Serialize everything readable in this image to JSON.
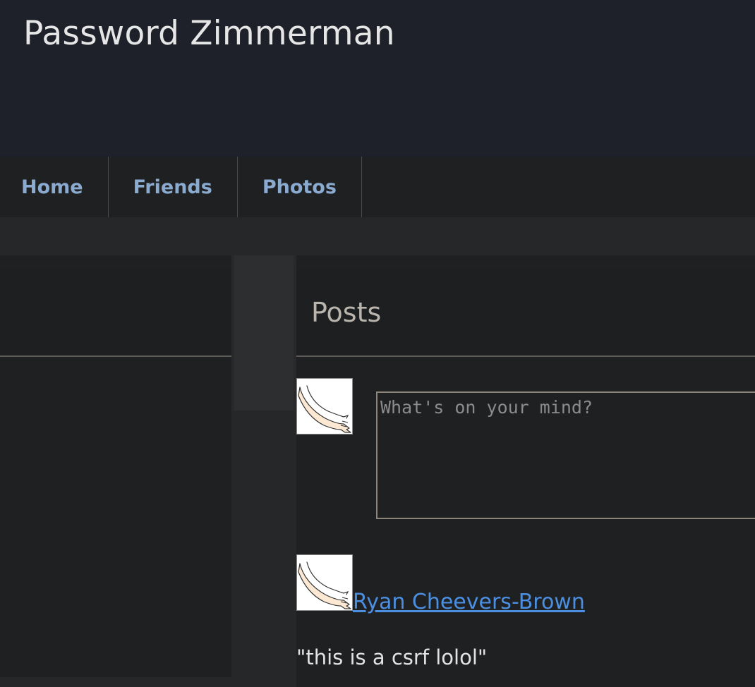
{
  "header": {
    "title": "Password Zimmerman"
  },
  "nav": {
    "items": [
      {
        "label": "Home"
      },
      {
        "label": "Friends"
      },
      {
        "label": "Photos"
      }
    ]
  },
  "posts": {
    "title": "Posts",
    "compose_placeholder": "What's on your mind?",
    "compose_value": "",
    "avatar_icon": "arm-drawing-icon",
    "list": [
      {
        "author": "Ryan Cheevers-Brown",
        "text": "\"this is a csrf lolol\""
      }
    ]
  }
}
